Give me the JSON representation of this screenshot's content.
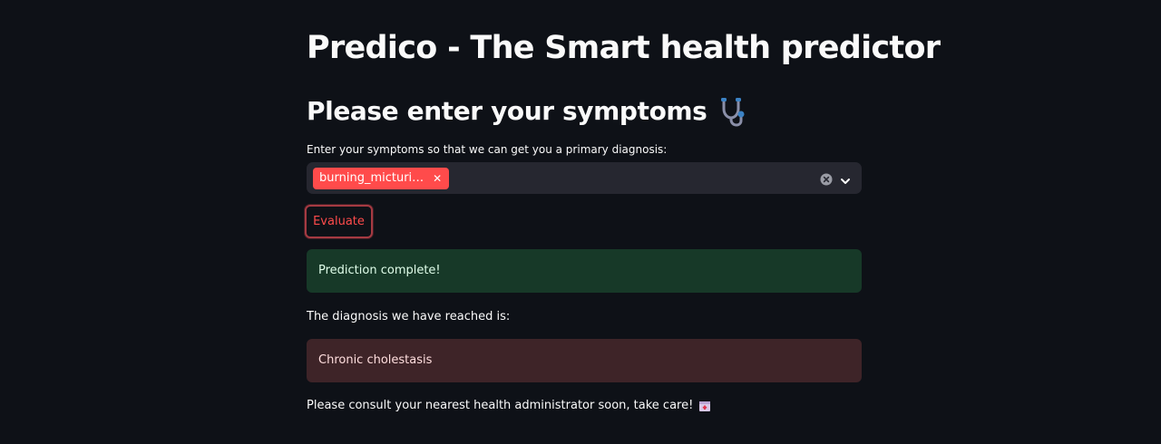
{
  "app": {
    "title": "Predico - The Smart health predictor"
  },
  "form": {
    "subheader": "Please enter your symptoms",
    "subheader_icon": "stethoscope-icon",
    "symptoms_label": "Enter your symptoms so that we can get you a primary diagnosis:",
    "selected_symptoms": [
      "burning_micturi…"
    ],
    "clear_icon": "clear-all-icon",
    "dropdown_icon": "chevron-down-icon",
    "evaluate_label": "Evaluate"
  },
  "results": {
    "success_message": "Prediction complete!",
    "diagnosis_intro": "The diagnosis we have reached is:",
    "diagnosis": "Chronic cholestasis",
    "consult_message": "Please consult your nearest health administrator soon, take care!",
    "consult_icon": "hospital-icon"
  },
  "colors": {
    "background": "#0e1117",
    "accent": "#ff4b4b",
    "input_bg": "#262730",
    "success_bg": "#173928",
    "error_bg": "#3e2428"
  }
}
